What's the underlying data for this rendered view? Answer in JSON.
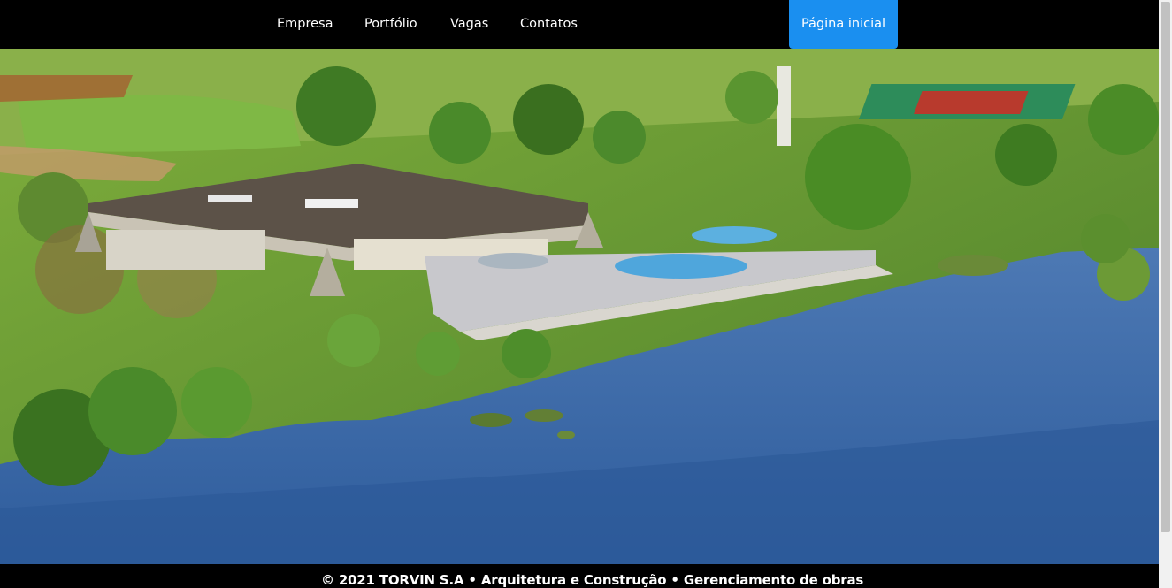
{
  "nav": {
    "items": [
      {
        "label": "Empresa"
      },
      {
        "label": "Portfólio"
      },
      {
        "label": "Vagas"
      },
      {
        "label": "Contatos"
      }
    ],
    "home_button": "Página inicial"
  },
  "footer": {
    "text": "© 2021 TORVIN S.A • Arquitetura e Construção • Gerenciamento de obras"
  },
  "colors": {
    "nav_background": "#000000",
    "home_button": "#1a8ff0",
    "footer_background": "#000000",
    "text": "#ffffff"
  }
}
